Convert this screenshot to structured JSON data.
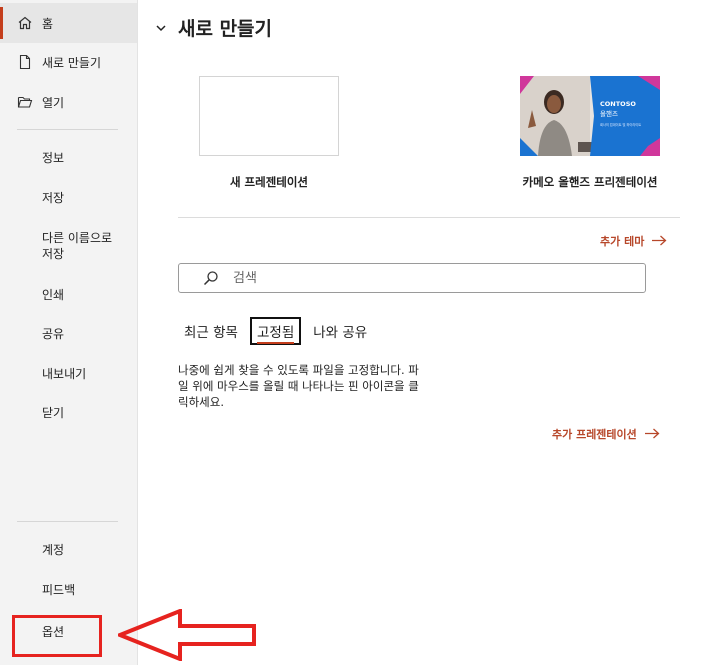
{
  "sidebar": {
    "home": "홈",
    "new": "새로 만들기",
    "open": "열기",
    "items": [
      "정보",
      "저장",
      "다른 이름으로 저장",
      "인쇄",
      "공유",
      "내보내기",
      "닫기"
    ],
    "bottom": [
      "계정",
      "피드백",
      "옵션"
    ]
  },
  "main": {
    "section_title": "새로 만들기",
    "templates": [
      {
        "label": "새 프레젠테이션"
      },
      {
        "label": "카메오 올핸즈 프리젠테이션",
        "thumb_brand": "CONTOSO",
        "thumb_title": "올핸즈",
        "thumb_sub": "회사의 업데이트 및 하이라이트"
      }
    ],
    "more_themes": "추가 테마",
    "search_placeholder": "검색",
    "tabs": [
      "최근 항목",
      "고정됨",
      "나와 공유"
    ],
    "active_tab": "고정됨",
    "pinned_description": "나중에 쉽게 찾을 수 있도록 파일을 고정합니다. 파일 위에 마우스를 올릴 때 나타나는 핀 아이콘을 클릭하세요.",
    "more_presentations": "추가 프레젠테이션"
  },
  "colors": {
    "accent": "#c43e1c",
    "annotation": "#e6231f",
    "thumb_blue": "#1a73d1",
    "thumb_magenta": "#d0379b"
  }
}
